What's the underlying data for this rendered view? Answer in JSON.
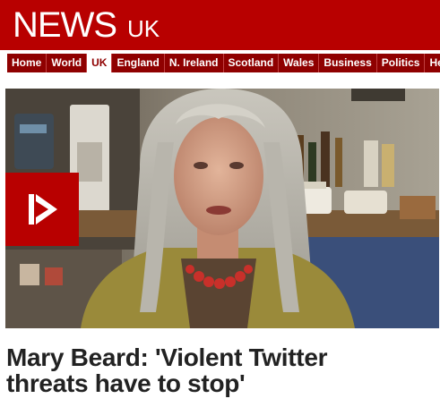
{
  "masthead": {
    "title": "NEWS",
    "section": "UK",
    "background": "#b80000"
  },
  "nav": {
    "background": "#8f0000",
    "items": [
      {
        "label": "Home",
        "active": false
      },
      {
        "label": "World",
        "active": false
      },
      {
        "label": "UK",
        "active": true
      },
      {
        "label": "England",
        "active": false
      },
      {
        "label": "N. Ireland",
        "active": false
      },
      {
        "label": "Scotland",
        "active": false
      },
      {
        "label": "Wales",
        "active": false
      },
      {
        "label": "Business",
        "active": false
      },
      {
        "label": "Politics",
        "active": false
      },
      {
        "label": "He",
        "active": false
      }
    ]
  },
  "video": {
    "play_icon": "play-icon"
  },
  "story": {
    "headline_line1": "Mary Beard: 'Violent Twitter",
    "headline_line2": "threats have to stop'"
  }
}
